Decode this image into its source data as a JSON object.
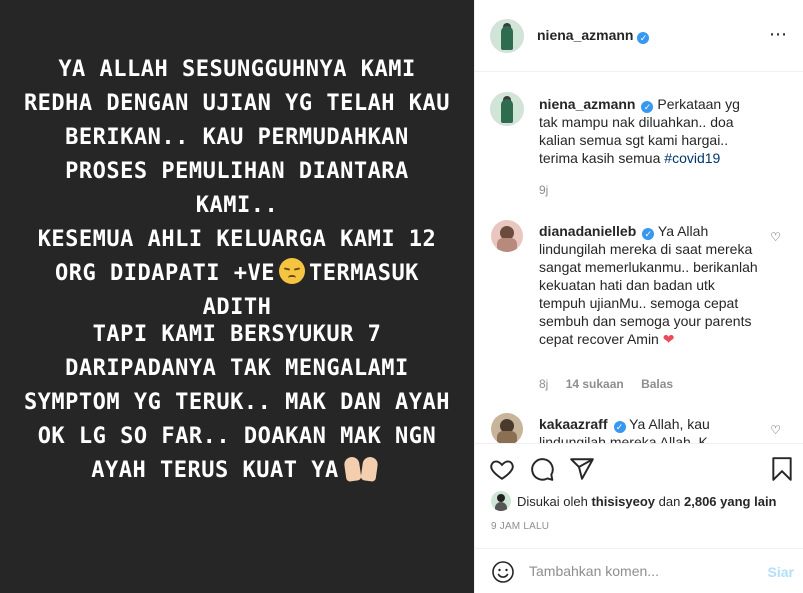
{
  "media": {
    "paragraph1": [
      "YA ALLAH SESUNGGUHNYA KAMI",
      "REDHA DENGAN UJIAN YG TELAH KAU",
      "BERIKAN.. KAU PERMUDAHKAN",
      "PROSES PEMULIHAN DIANTARA KAMI..",
      "KESEMUA AHLI KELUARGA KAMI 12"
    ],
    "line6_before": "ORG DIDAPATI +VE",
    "line6_after": "TERMASUK",
    "line7": "ADITH",
    "paragraph2": [
      "TAPI KAMI BERSYUKUR 7",
      "DARIPADANYA TAK MENGALAMI",
      "SYMPTOM YG TERUK.. MAK DAN AYAH",
      "OK LG SO FAR.. DOAKAN MAK NGN"
    ],
    "last_line": "AYAH TERUS KUAT YA",
    "emoji_names": [
      "pensive-face-emoji",
      "palms-up-emoji"
    ]
  },
  "header": {
    "username": "niena_azmann",
    "more_icon": "⋯"
  },
  "caption": {
    "username": "niena_azmann",
    "text": "Perkataan yg tak mampu nak diluahkan.. doa kalian semua sgt kami hargai.. terima kasih semua",
    "hashtag": "#covid19",
    "age": "9j"
  },
  "comments": [
    {
      "username": "dianadanielleb",
      "text": "Ya Allah lindungilah mereka di saat mereka sangat memerlukanmu.. berikanlah kekuatan hati dan badan utk tempuh ujianMu.. semoga cepat sembuh dan semoga your parents cepat recover Amin",
      "emoji": "❤",
      "age": "8j",
      "likes": "14 sukaan",
      "reply": "Balas"
    },
    {
      "username": "kakaazraff",
      "text": "Ya Allah, kau",
      "partial_line": "lindungilah mereka Allah, K"
    }
  ],
  "actions": {
    "icons": [
      "heart-icon",
      "comment-icon",
      "share-icon",
      "bookmark-icon"
    ]
  },
  "likes": {
    "prefix": "Disukai oleh",
    "user": "thisisyeoy",
    "middle": "dan",
    "count": "2,806 yang lain"
  },
  "timestamp": "9 JAM LALU",
  "add_comment": {
    "placeholder": "Tambahkan komen...",
    "post_label": "Siar"
  },
  "colors": {
    "media_bg": "#262626",
    "verified": "#3897f0",
    "hashtag": "#00376b",
    "heart_red": "#ed4956",
    "post_disabled": "#b2dffc"
  }
}
